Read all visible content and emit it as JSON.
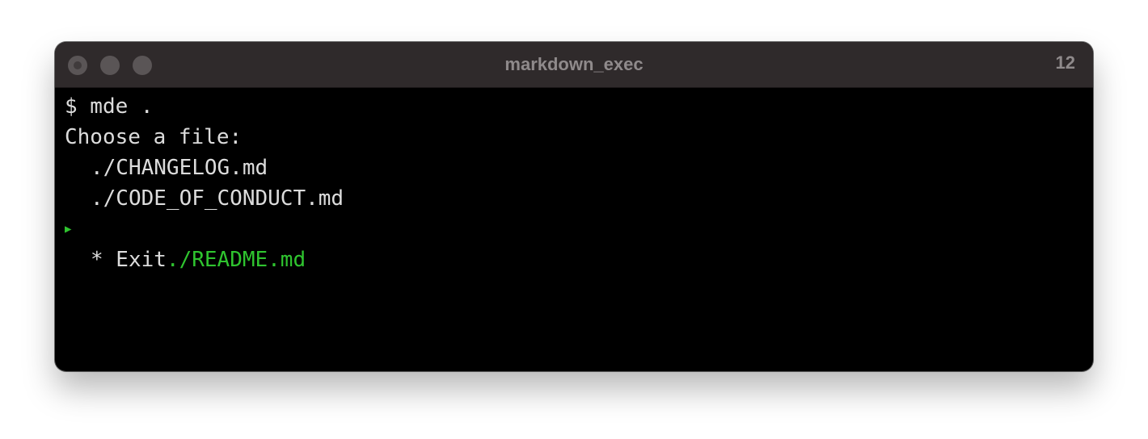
{
  "window": {
    "title": "markdown_exec",
    "count": "12"
  },
  "terminal": {
    "command": "$ mde .",
    "prompt": "Choose a file:",
    "options": [
      "./CHANGELOG.md",
      "./CODE_OF_CONDUCT.md",
      "./README.md",
      "* Exit"
    ],
    "selected_index": 2,
    "pointer_icon": "triangle-right-icon"
  },
  "colors": {
    "selected": "#2fc42f",
    "text": "#dcdcdc",
    "background": "#000000",
    "titlebar": "#2f2a2b"
  }
}
